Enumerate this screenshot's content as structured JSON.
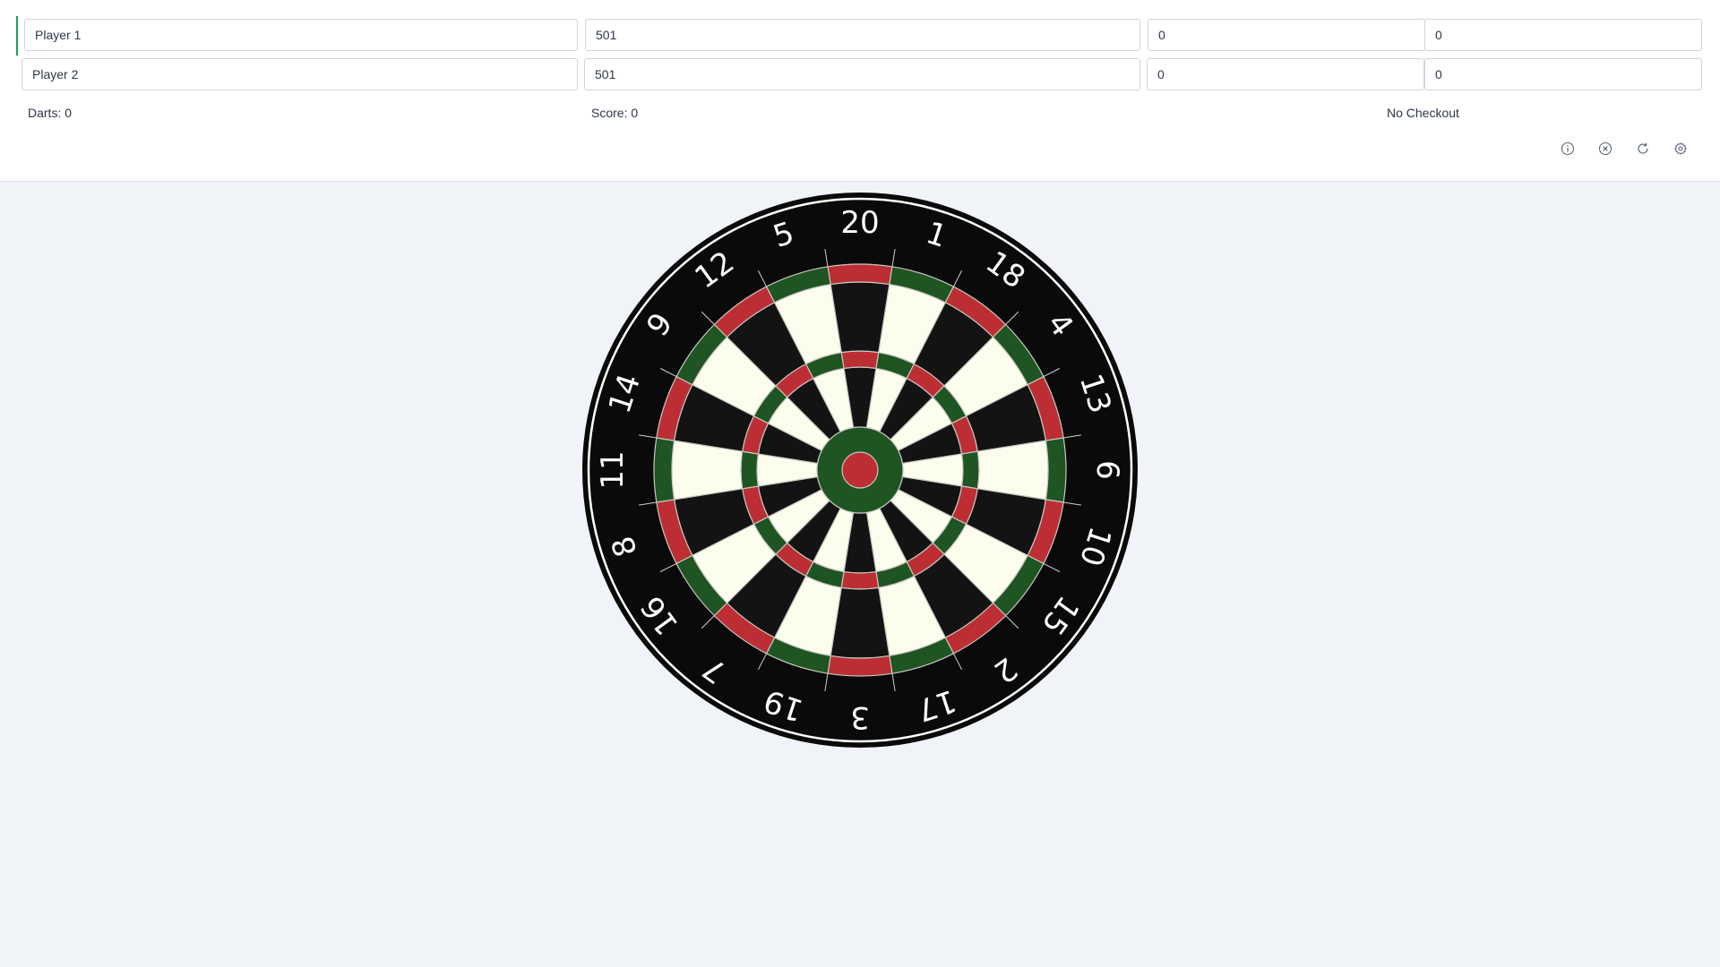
{
  "players": [
    {
      "name": "Player 1",
      "score": "501",
      "legs": "0",
      "sets": "0",
      "active": true
    },
    {
      "name": "Player 2",
      "score": "501",
      "legs": "0",
      "sets": "0",
      "active": false
    }
  ],
  "status": {
    "darts": "Darts: 0",
    "score": "Score: 0",
    "checkout": "No Checkout"
  },
  "toolbar": {
    "info_icon": "info-icon",
    "clear_icon": "close-circle-icon",
    "reset_icon": "refresh-icon",
    "settings_icon": "gear-icon"
  },
  "dartboard": {
    "numbers": [
      20,
      1,
      18,
      4,
      13,
      6,
      10,
      15,
      2,
      17,
      3,
      19,
      7,
      16,
      8,
      11,
      14,
      9,
      12,
      5
    ],
    "colors": {
      "dark": "#131313",
      "light": "#fdfdee",
      "red": "#bc2e33",
      "green": "#1f5423",
      "board": "#0a0a0a",
      "wire": "#c7c7c0"
    }
  }
}
